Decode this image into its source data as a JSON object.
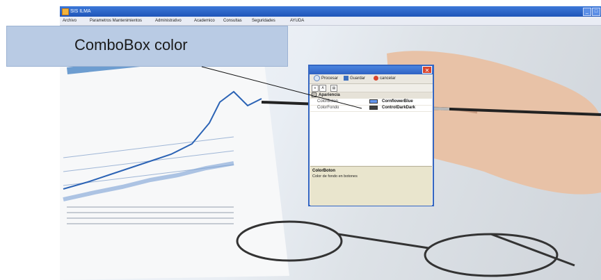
{
  "window": {
    "title": "SIS ILMA",
    "minimize_glyph": "_",
    "maximize_glyph": "□"
  },
  "menu": [
    "Archivo",
    "Parametros Mantenimientos",
    "Administrativo",
    "Academico",
    "Consultas",
    "Seguridades",
    "AYUDA"
  ],
  "overlay_label": "ComboBox color",
  "dialog": {
    "close_glyph": "✕",
    "toolbar": {
      "procesar": "Procesar",
      "guardar": "Guardar",
      "cancelar": "cancelar"
    },
    "property_grid": {
      "category": "Apariencia",
      "properties": [
        {
          "name": "ColorBoton",
          "value": "CornflowerBlue",
          "color": "#6495ed"
        },
        {
          "name": "ColorFondo",
          "value": "ControlDarkDark",
          "color": "#404040"
        }
      ]
    },
    "help": {
      "title": "ColorBoton",
      "description": "Color de fondo en botones"
    }
  },
  "colors": {
    "titlebar": "#2a63c9",
    "overlay_bg": "#b9cbe4",
    "close_button": "#d8452e"
  }
}
